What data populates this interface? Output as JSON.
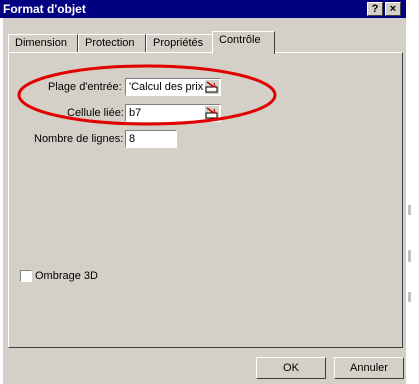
{
  "window": {
    "title": "Format d'objet",
    "help_button": "?",
    "close_button": "×"
  },
  "tabs": [
    {
      "label": "Dimension"
    },
    {
      "label": "Protection"
    },
    {
      "label": "Propriétés"
    },
    {
      "label": "Contrôle",
      "active": true
    }
  ],
  "form": {
    "input_range": {
      "label": "Plage d'entrée:",
      "value": "'Calcul des prix"
    },
    "cell_link": {
      "label": "Cellule liée:",
      "value": "b7"
    },
    "lines": {
      "label": "Nombre de lignes:",
      "value": "8"
    },
    "shading_3d": {
      "label": "Ombrage 3D",
      "checked": false
    }
  },
  "buttons": {
    "ok": "OK",
    "cancel": "Annuler"
  },
  "colors": {
    "titlebar": "#000080",
    "face": "#d4d0c8",
    "highlight_oval": "#e00000"
  }
}
